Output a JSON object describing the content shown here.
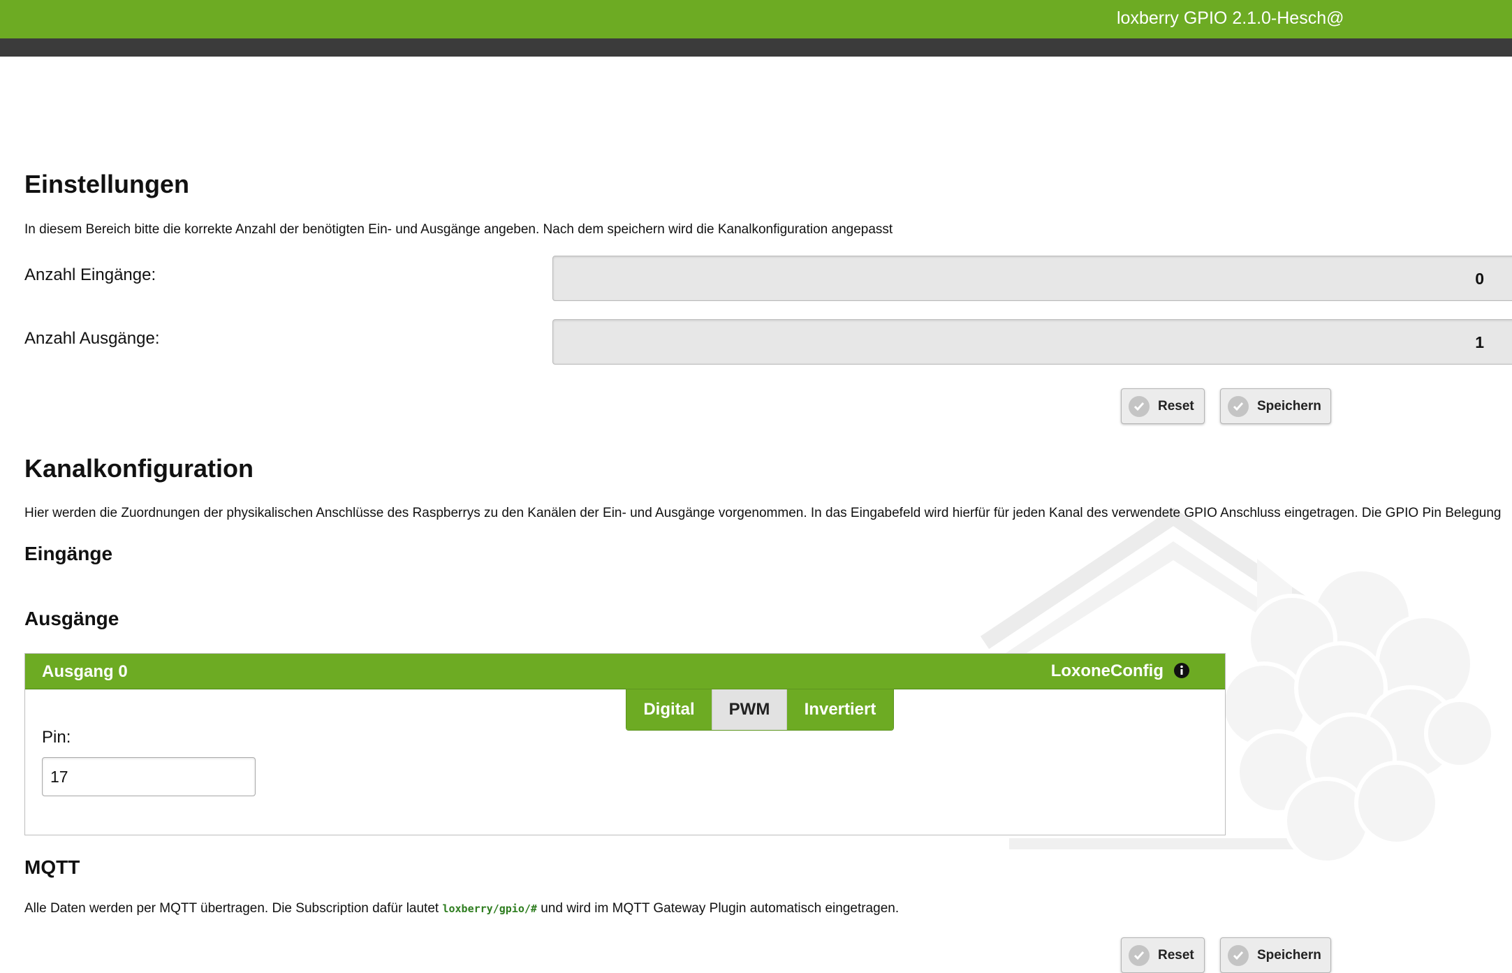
{
  "header": {
    "title": "loxberry GPIO 2.1.0-Hesch@"
  },
  "settings": {
    "heading": "Einstellungen",
    "description": "In diesem Bereich bitte die korrekte Anzahl der benötigten Ein- und Ausgänge angeben. Nach dem speichern wird die Kanalkonfiguration angepasst",
    "inputs_label": "Anzahl Eingänge:",
    "inputs_value": "0",
    "outputs_label": "Anzahl Ausgänge:",
    "outputs_value": "1",
    "reset_label": "Reset",
    "save_label": "Speichern"
  },
  "channels": {
    "heading": "Kanalkonfiguration",
    "description": "Hier werden die Zuordnungen der physikalischen Anschlüsse des Raspberrys zu den Kanälen der Ein- und Ausgänge vorgenommen. In das Eingabefeld wird hierfür für jeden Kanal des verwendete GPIO Anschluss eingetragen. Die GPIO Pin Belegung",
    "inputs_heading": "Eingänge",
    "outputs_heading": "Ausgänge"
  },
  "output0": {
    "title": "Ausgang 0",
    "loxone_label": "LoxoneConfig",
    "modes": [
      "Digital",
      "PWM",
      "Invertiert"
    ],
    "selected_mode": "PWM",
    "pin_label": "Pin:",
    "pin_value": "17"
  },
  "mqtt": {
    "heading": "MQTT",
    "text_before": "Alle Daten werden per MQTT übertragen. Die Subscription dafür lautet ",
    "topic": "loxberry/gpio/#",
    "text_after": " und wird im MQTT Gateway Plugin automatisch eingetragen.",
    "reset_label": "Reset",
    "save_label": "Speichern"
  },
  "colors": {
    "brand_green": "#6dab23",
    "dark_bar": "#3b3b3b"
  },
  "icons": {
    "button_icon": "check-icon",
    "info_icon": "info-icon",
    "watermark": "loxberry-logo"
  }
}
